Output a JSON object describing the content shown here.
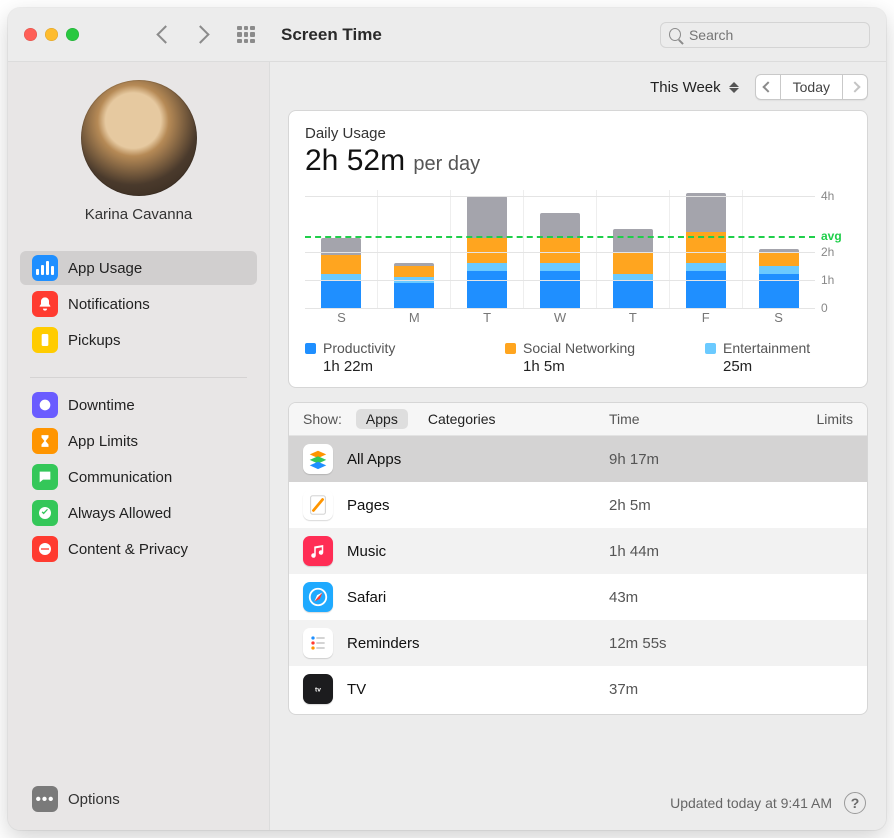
{
  "window": {
    "title": "Screen Time"
  },
  "search": {
    "placeholder": "Search"
  },
  "toprow": {
    "range_label": "This Week",
    "today_label": "Today"
  },
  "sidebar": {
    "username": "Karina Cavanna",
    "items": [
      {
        "label": "App Usage",
        "icon": "bars-icon",
        "icon_bg": "#1f8fff",
        "selected": true
      },
      {
        "label": "Notifications",
        "icon": "bell-icon",
        "icon_bg": "#ff3b30",
        "selected": false
      },
      {
        "label": "Pickups",
        "icon": "hand-phone-icon",
        "icon_bg": "#ffcc00",
        "selected": false
      }
    ],
    "items2": [
      {
        "label": "Downtime",
        "icon": "clock-moon-icon",
        "icon_bg": "#6a5cff"
      },
      {
        "label": "App Limits",
        "icon": "hourglass-icon",
        "icon_bg": "#ff9500"
      },
      {
        "label": "Communication",
        "icon": "chat-bubble-icon",
        "icon_bg": "#34c759"
      },
      {
        "label": "Always Allowed",
        "icon": "check-shield-icon",
        "icon_bg": "#34c759"
      },
      {
        "label": "Content & Privacy",
        "icon": "no-entry-icon",
        "icon_bg": "#ff3b30"
      }
    ],
    "options_label": "Options"
  },
  "usage": {
    "title": "Daily Usage",
    "total": "2h 52m",
    "per_label": "per day",
    "legend": [
      {
        "name": "Productivity",
        "value": "1h 22m",
        "color": "#1f8fff"
      },
      {
        "name": "Social Networking",
        "value": "1h 5m",
        "color": "#ffa51f"
      },
      {
        "name": "Entertainment",
        "value": "25m",
        "color": "#6bcaff"
      }
    ]
  },
  "chart_data": {
    "type": "bar",
    "stacked": true,
    "categories": [
      "S",
      "M",
      "T",
      "W",
      "T",
      "F",
      "S"
    ],
    "ylim": [
      0,
      4.2
    ],
    "yticks": [
      0,
      1,
      2,
      4
    ],
    "ytick_labels": [
      "0",
      "1h",
      "2h",
      "4h"
    ],
    "avg_value": 2.55,
    "avg_label": "avg",
    "series": [
      {
        "name": "Productivity",
        "color": "#1f8fff",
        "values": [
          1.0,
          0.9,
          1.3,
          1.3,
          1.0,
          1.3,
          1.2
        ]
      },
      {
        "name": "Entertainment",
        "color": "#6bcaff",
        "values": [
          0.2,
          0.2,
          0.3,
          0.3,
          0.2,
          0.3,
          0.3
        ]
      },
      {
        "name": "Social Networking",
        "color": "#ffa51f",
        "values": [
          0.7,
          0.4,
          0.9,
          0.9,
          0.8,
          1.1,
          0.5
        ]
      },
      {
        "name": "Other",
        "color": "#a4a4ac",
        "values": [
          0.6,
          0.1,
          1.5,
          0.9,
          0.8,
          1.4,
          0.1
        ]
      }
    ]
  },
  "table": {
    "show_label": "Show:",
    "tab_apps": "Apps",
    "tab_categories": "Categories",
    "col_time": "Time",
    "col_limits": "Limits",
    "rows": [
      {
        "name": "All Apps",
        "time": "9h 17m",
        "icon": "stack-icon",
        "icon_bg": "#ffffff",
        "icon_fg": "#555",
        "selected": true
      },
      {
        "name": "Pages",
        "time": "2h 5m",
        "icon": "pages-icon",
        "icon_bg": "#ffffff"
      },
      {
        "name": "Music",
        "time": "1h 44m",
        "icon": "music-icon",
        "icon_bg": "#ff2d55"
      },
      {
        "name": "Safari",
        "time": "43m",
        "icon": "safari-icon",
        "icon_bg": "#1faaff"
      },
      {
        "name": "Reminders",
        "time": "12m 55s",
        "icon": "reminders-icon",
        "icon_bg": "#ffffff"
      },
      {
        "name": "TV",
        "time": "37m",
        "icon": "tv-icon",
        "icon_bg": "#1c1c1e"
      }
    ]
  },
  "footer": {
    "updated": "Updated today at 9:41 AM"
  }
}
